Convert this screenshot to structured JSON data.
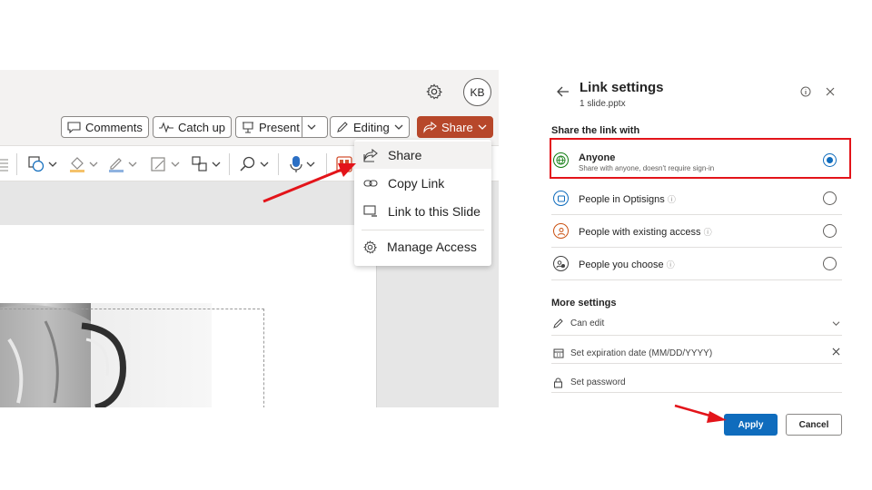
{
  "left": {
    "avatar_initials": "KB",
    "commands": {
      "comments": "Comments",
      "catch_up": "Catch up",
      "present": "Present",
      "editing": "Editing",
      "share": "Share"
    },
    "share_menu": {
      "items": [
        {
          "label": "Share",
          "icon": "share-icon"
        },
        {
          "label": "Copy Link",
          "icon": "link-icon"
        },
        {
          "label": "Link to this Slide",
          "icon": "slide-link-icon"
        },
        {
          "label": "Manage Access",
          "icon": "gear-icon"
        }
      ]
    },
    "colors": {
      "share_accent": "#b7472a"
    }
  },
  "link_settings": {
    "title": "Link settings",
    "file_name": "1 slide.pptx",
    "share_with_label": "Share the link with",
    "options": [
      {
        "label": "Anyone",
        "description": "Share with anyone, doesn't require sign-in",
        "icon": "globe-icon",
        "selected": true
      },
      {
        "label": "People in Optisigns",
        "description": "",
        "icon": "building-icon",
        "selected": false
      },
      {
        "label": "People with existing access",
        "description": "",
        "icon": "person-icon",
        "selected": false
      },
      {
        "label": "People you choose",
        "description": "",
        "icon": "people-icon",
        "selected": false
      }
    ],
    "info_glyph": "ⓘ",
    "more_settings_label": "More settings",
    "permission": "Can edit",
    "expiration_placeholder": "Set expiration date (MM/DD/YYYY)",
    "password_placeholder": "Set password",
    "apply_label": "Apply",
    "cancel_label": "Cancel",
    "colors": {
      "primary": "#0f6cbd",
      "highlight": "#e3141a"
    }
  }
}
